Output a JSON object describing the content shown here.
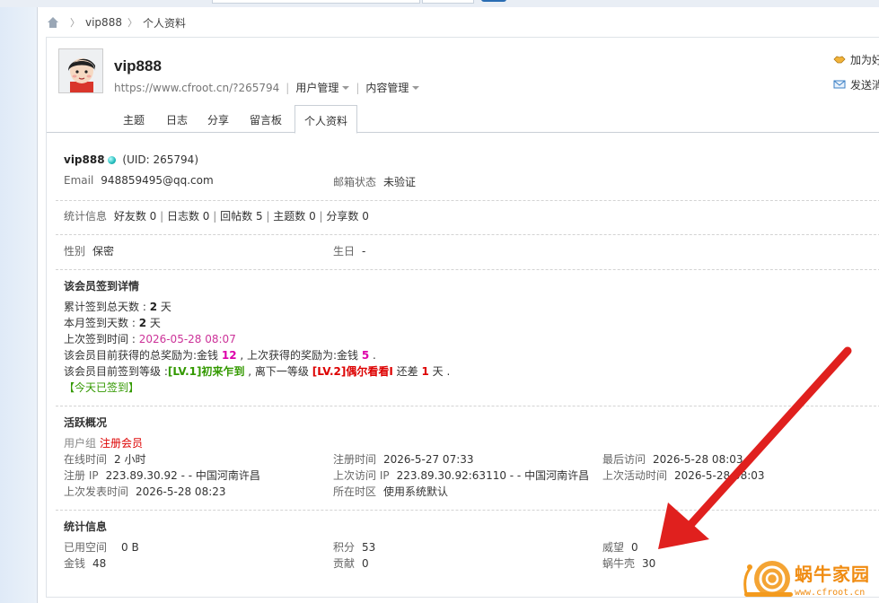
{
  "breadcrumb": {
    "items": [
      "vip888",
      "个人资料"
    ]
  },
  "profile": {
    "username": "vip888",
    "url": "https://www.cfroot.cn/?265794",
    "menus": [
      "用户管理",
      "内容管理"
    ],
    "actions": [
      "加为好",
      "发送消"
    ]
  },
  "tabs": [
    "主题",
    "日志",
    "分享",
    "留言板",
    "个人资料"
  ],
  "basic": {
    "name": "vip888",
    "uid": "(UID: 265794)",
    "email_label": "Email",
    "email": "948859495@qq.com",
    "email_status_label": "邮箱状态",
    "email_status": "未验证",
    "stats_label": "统计信息",
    "stats": [
      "好友数 0",
      "日志数 0",
      "回帖数 5",
      "主题数 0",
      "分享数 0"
    ],
    "gender_label": "性别",
    "gender": "保密",
    "birthday_label": "生日",
    "birthday": "-"
  },
  "signin": {
    "title": "该会员签到详情",
    "total_label": "累计签到总天数 : ",
    "total": "2",
    "total_unit": " 天",
    "month_label": "本月签到天数 : ",
    "month": "2",
    "month_unit": " 天",
    "last_label": "上次签到时间 : ",
    "last_time": "2026-05-28 08:07",
    "reward_p1": "该会员目前获得的总奖励为:金钱 ",
    "reward_total": "12",
    "reward_p2": " , 上次获得的奖励为:金钱 ",
    "reward_last": "5",
    "reward_p3": " .",
    "level_p1": "该会员目前签到等级 :",
    "level_cur": "[LV.1]初来乍到",
    "level_p2": " , 离下一等级 ",
    "level_next": "[LV.2]偶尔看看I",
    "level_p3": " 还差 ",
    "level_diff": "1",
    "level_p4": " 天 .",
    "today": "【今天已签到】"
  },
  "activity": {
    "title": "活跃概况",
    "group_label": "用户组",
    "group": "注册会员",
    "rows": [
      [
        [
          "在线时间",
          "2 小时"
        ],
        [
          "注册时间",
          "2026-5-27 07:33"
        ],
        [
          "最后访问",
          "2026-5-28 08:03"
        ]
      ],
      [
        [
          "注册 IP",
          "223.89.30.92 - - 中国河南许昌"
        ],
        [
          "上次访问 IP",
          "223.89.30.92:63110 - - 中国河南许昌"
        ],
        [
          "上次活动时间",
          "2026-5-28 08:03"
        ]
      ],
      [
        [
          "上次发表时间",
          "2026-5-28 08:23"
        ],
        [
          "所在时区",
          "使用系统默认"
        ],
        null
      ]
    ]
  },
  "stats": {
    "title": "统计信息",
    "rows": [
      [
        [
          "已用空间",
          "0 B"
        ],
        [
          "积分",
          "53"
        ],
        [
          "威望",
          "0"
        ]
      ],
      [
        [
          "金钱",
          "48"
        ],
        [
          "贡献",
          "0"
        ],
        [
          "蜗牛壳",
          "30"
        ]
      ]
    ]
  },
  "watermark": {
    "text": "蜗牛家园",
    "site": "www.cfroot.cn"
  },
  "colors": {
    "accent": "#cc3399",
    "green": "#339900",
    "red": "#dd0000",
    "arrow": "#e0201e"
  }
}
